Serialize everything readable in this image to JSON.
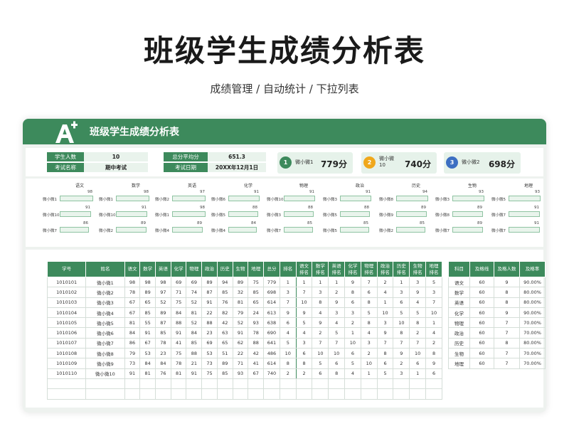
{
  "page": {
    "title": "班级学生成绩分析表",
    "subtitle": "成绩管理 / 自动统计 / 下拉列表"
  },
  "header": {
    "title": "班级学生成绩分析表",
    "logo_icon": "a-plus-icon"
  },
  "colors": {
    "primary": "#3d8a5c",
    "light": "#e9f3ec",
    "gold": "#f0a81c",
    "blue": "#3d6fc2"
  },
  "info": {
    "student_count_label": "学生人数",
    "student_count": "10",
    "exam_name_label": "考试名称",
    "exam_name": "期中考试",
    "avg_label": "总分平均分",
    "avg": "651.3",
    "date_label": "考试日期",
    "date": "20XX年12月1日"
  },
  "ranking": [
    {
      "rank": "1",
      "name": "微小微1",
      "score": "779分",
      "color": "#3d8a5c"
    },
    {
      "rank": "2",
      "name": "微小微10",
      "score": "740分",
      "color": "#f0a81c"
    },
    {
      "rank": "3",
      "name": "微小微2",
      "score": "698分",
      "color": "#3d6fc2"
    }
  ],
  "top_scores": [
    {
      "subject": "语文",
      "entries": [
        {
          "name": "微小微1",
          "value": 98
        },
        {
          "name": "微小微10",
          "value": 91
        },
        {
          "name": "微小微7",
          "value": 86
        }
      ]
    },
    {
      "subject": "数学",
      "entries": [
        {
          "name": "微小微1",
          "value": 98
        },
        {
          "name": "微小微10",
          "value": 91
        },
        {
          "name": "微小微2",
          "value": 89
        }
      ]
    },
    {
      "subject": "英语",
      "entries": [
        {
          "name": "微小微2",
          "value": 97
        },
        {
          "name": "微小微1",
          "value": 98
        },
        {
          "name": "微小微4",
          "value": 89
        }
      ]
    },
    {
      "subject": "化学",
      "entries": [
        {
          "name": "微小微6",
          "value": 91
        },
        {
          "name": "微小微5",
          "value": 88
        },
        {
          "name": "微小微4",
          "value": 84
        }
      ]
    },
    {
      "subject": "物理",
      "entries": [
        {
          "name": "微小微10",
          "value": 91
        },
        {
          "name": "微小微3",
          "value": 88
        },
        {
          "name": "微小微7",
          "value": 85
        }
      ]
    },
    {
      "subject": "政治",
      "entries": [
        {
          "name": "微小微3",
          "value": 91
        },
        {
          "name": "微小微5",
          "value": 88
        },
        {
          "name": "微小微5",
          "value": 85
        }
      ]
    },
    {
      "subject": "历史",
      "entries": [
        {
          "name": "微小微8",
          "value": 94
        },
        {
          "name": "微小微9",
          "value": 89
        },
        {
          "name": "微小微2",
          "value": 85
        }
      ]
    },
    {
      "subject": "生物",
      "entries": [
        {
          "name": "微小微3",
          "value": 93
        },
        {
          "name": "微小微8",
          "value": 89
        },
        {
          "name": "微小微7",
          "value": 89
        }
      ]
    },
    {
      "subject": "地理",
      "entries": [
        {
          "name": "微小微5",
          "value": 93
        },
        {
          "name": "微小微7",
          "value": 91
        },
        {
          "name": "微小微7",
          "value": 91
        }
      ]
    }
  ],
  "main_table": {
    "headers": [
      "学号",
      "姓名",
      "语文",
      "数学",
      "英语",
      "化学",
      "物理",
      "政治",
      "历史",
      "生物",
      "地理",
      "总分",
      "排名",
      "语文排名",
      "数学排名",
      "英语排名",
      "化学排名",
      "物理排名",
      "政治排名",
      "历史排名",
      "生物排名",
      "地理排名"
    ],
    "rows": [
      [
        "1010101",
        "微小微1",
        "98",
        "98",
        "98",
        "69",
        "69",
        "89",
        "94",
        "89",
        "75",
        "779",
        "1",
        "1",
        "1",
        "1",
        "9",
        "7",
        "2",
        "1",
        "3",
        "5"
      ],
      [
        "1010102",
        "微小微2",
        "78",
        "89",
        "97",
        "71",
        "74",
        "87",
        "85",
        "32",
        "85",
        "698",
        "3",
        "7",
        "3",
        "2",
        "8",
        "6",
        "4",
        "3",
        "9",
        "3"
      ],
      [
        "1010103",
        "微小微3",
        "67",
        "65",
        "52",
        "75",
        "52",
        "91",
        "76",
        "81",
        "65",
        "614",
        "7",
        "10",
        "8",
        "9",
        "6",
        "8",
        "1",
        "6",
        "4",
        "7"
      ],
      [
        "1010104",
        "微小微4",
        "67",
        "85",
        "89",
        "84",
        "81",
        "22",
        "82",
        "79",
        "24",
        "613",
        "9",
        "9",
        "4",
        "3",
        "3",
        "5",
        "10",
        "5",
        "5",
        "10"
      ],
      [
        "1010105",
        "微小微5",
        "81",
        "55",
        "87",
        "88",
        "52",
        "88",
        "42",
        "52",
        "93",
        "638",
        "6",
        "5",
        "9",
        "4",
        "2",
        "8",
        "3",
        "10",
        "8",
        "1"
      ],
      [
        "1010106",
        "微小微6",
        "84",
        "91",
        "85",
        "91",
        "84",
        "23",
        "63",
        "91",
        "78",
        "690",
        "4",
        "4",
        "2",
        "5",
        "1",
        "4",
        "9",
        "8",
        "2",
        "4"
      ],
      [
        "1010107",
        "微小微7",
        "86",
        "67",
        "78",
        "41",
        "85",
        "69",
        "65",
        "62",
        "88",
        "641",
        "5",
        "3",
        "7",
        "7",
        "10",
        "3",
        "7",
        "7",
        "7",
        "2"
      ],
      [
        "1010108",
        "微小微8",
        "79",
        "53",
        "23",
        "75",
        "88",
        "53",
        "51",
        "22",
        "42",
        "486",
        "10",
        "6",
        "10",
        "10",
        "6",
        "2",
        "8",
        "9",
        "10",
        "8"
      ],
      [
        "1010109",
        "微小微9",
        "73",
        "84",
        "84",
        "78",
        "21",
        "73",
        "89",
        "71",
        "41",
        "614",
        "8",
        "8",
        "5",
        "6",
        "5",
        "10",
        "6",
        "2",
        "6",
        "9"
      ],
      [
        "1010110",
        "微小微10",
        "91",
        "81",
        "76",
        "81",
        "91",
        "75",
        "85",
        "93",
        "67",
        "740",
        "2",
        "2",
        "6",
        "8",
        "4",
        "1",
        "5",
        "3",
        "1",
        "6"
      ]
    ],
    "empty_rows": 2
  },
  "pass_table": {
    "headers": [
      "科目",
      "及格线",
      "及格人数",
      "及格率"
    ],
    "rows": [
      [
        "语文",
        "60",
        "9",
        "90.00%"
      ],
      [
        "数学",
        "60",
        "8",
        "80.00%"
      ],
      [
        "英语",
        "60",
        "8",
        "80.00%"
      ],
      [
        "化学",
        "60",
        "9",
        "90.00%"
      ],
      [
        "物理",
        "60",
        "7",
        "70.00%"
      ],
      [
        "政治",
        "60",
        "7",
        "70.00%"
      ],
      [
        "历史",
        "60",
        "8",
        "80.00%"
      ],
      [
        "生物",
        "60",
        "7",
        "70.00%"
      ],
      [
        "地理",
        "60",
        "7",
        "70.00%"
      ]
    ]
  }
}
